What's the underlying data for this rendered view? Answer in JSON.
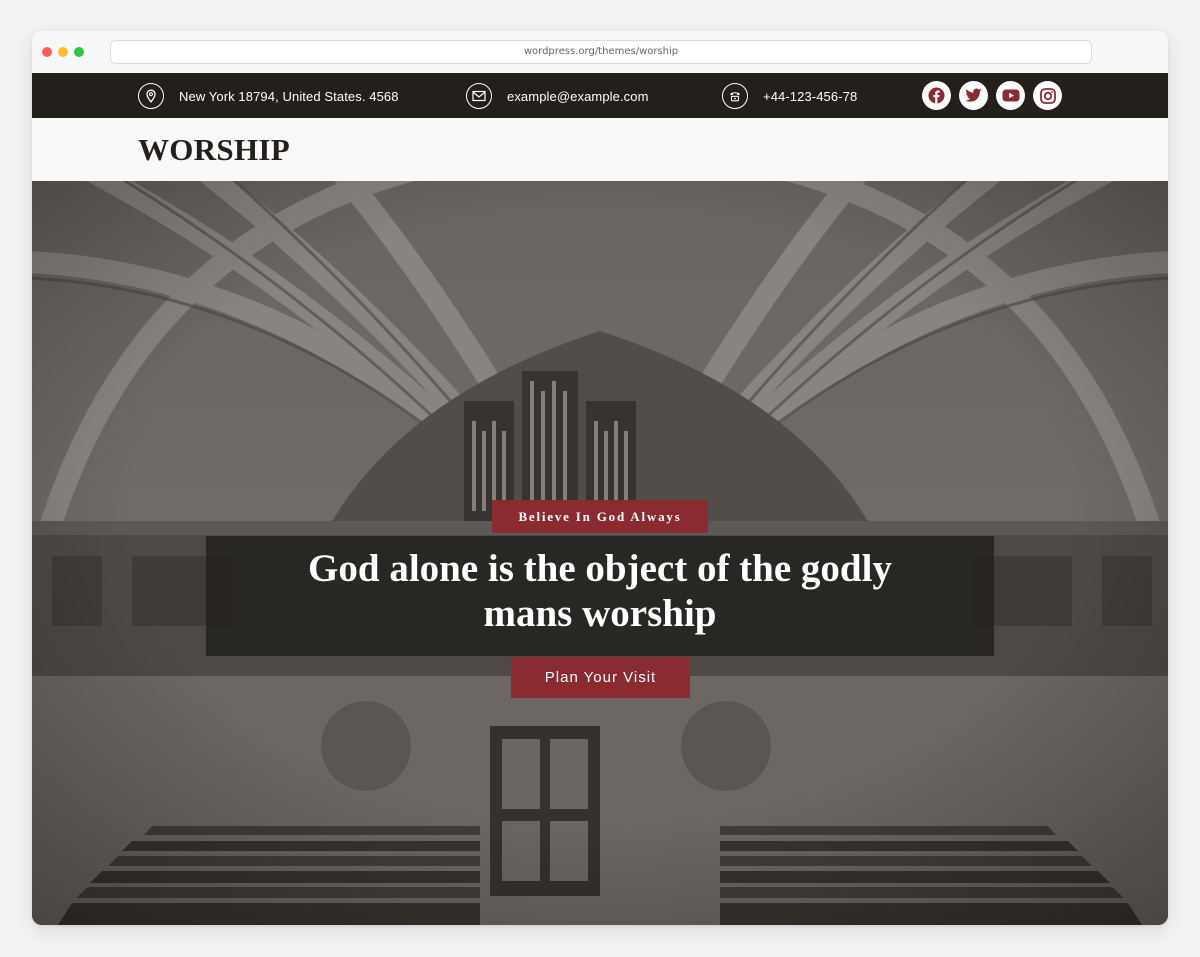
{
  "browser": {
    "url": "wordpress.org/themes/worship"
  },
  "topbar": {
    "address": "New York 18794, United States. 4568",
    "email": "example@example.com",
    "phone": "+44-123-456-78",
    "socials": [
      "facebook-icon",
      "twitter-icon",
      "youtube-icon",
      "instagram-icon"
    ]
  },
  "header": {
    "logo": "WORSHIP"
  },
  "hero": {
    "tagline": "Believe In God Always",
    "headline_line1": "God alone is the object of the godly",
    "headline_line2": "mans worship",
    "cta_label": "Plan Your Visit"
  },
  "colors": {
    "topbar_bg": "#231f1b",
    "accent": "#8a2a31",
    "header_bg": "#f9f9f9"
  }
}
